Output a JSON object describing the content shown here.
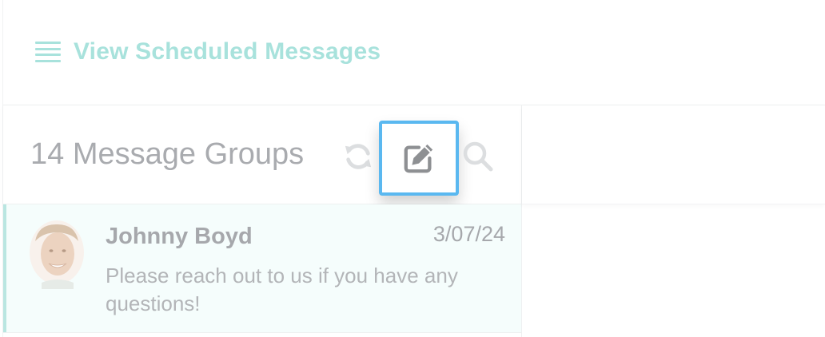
{
  "header": {
    "scheduled_link_label": "View Scheduled Messages",
    "menu_icon": "hamburger-menu-icon"
  },
  "list": {
    "title": "14 Message Groups",
    "toolbar": {
      "refresh_icon": "refresh-icon",
      "compose_icon": "compose-icon",
      "search_icon": "search-icon"
    },
    "items": [
      {
        "name": "Johnny Boyd",
        "date": "3/07/24",
        "preview": "Please reach out to us if you have any questions!",
        "avatar": "avatar"
      }
    ]
  },
  "colors": {
    "accent_teal": "#a8e2dc",
    "highlight_blue": "#5ab8f0",
    "muted_text": "#a9abaf",
    "row_bg": "#f5fdfc"
  }
}
